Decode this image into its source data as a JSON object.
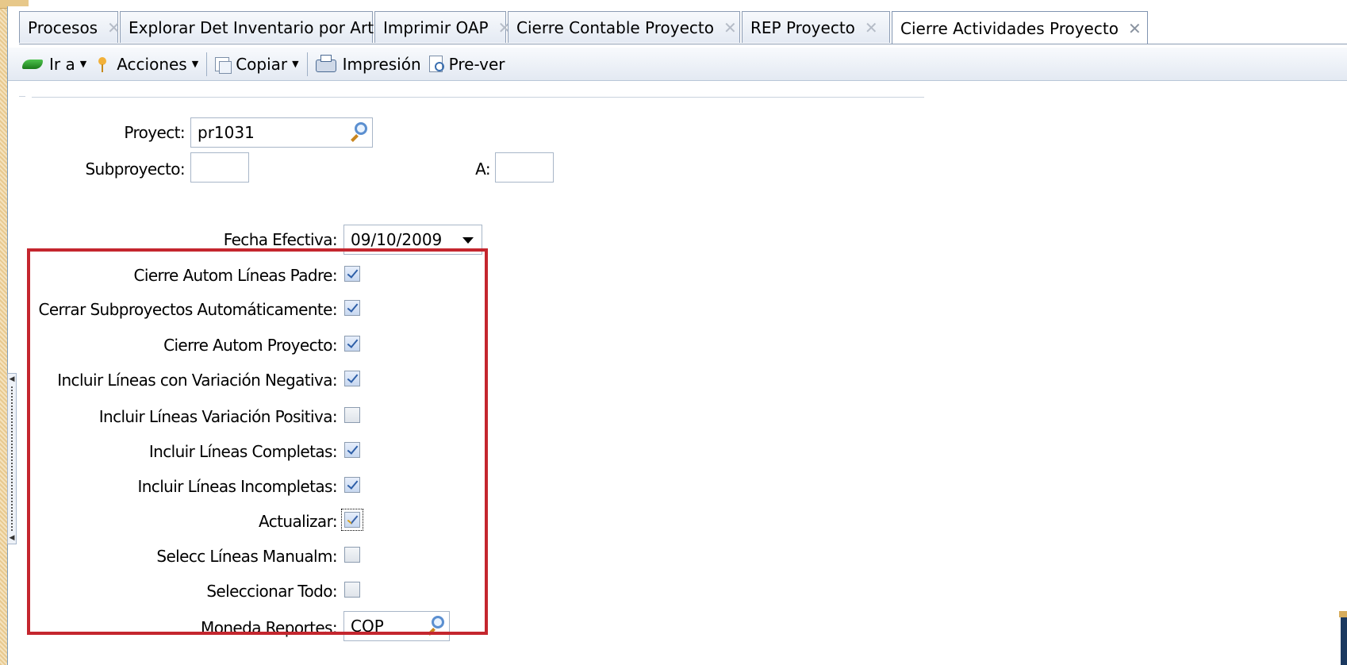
{
  "tabs": [
    {
      "label": "Procesos"
    },
    {
      "label": "Explorar Det Inventario por Art"
    },
    {
      "label": "Imprimir OAP"
    },
    {
      "label": "Cierre Contable Proyecto"
    },
    {
      "label": "REP Proyecto"
    },
    {
      "label": "Cierre Actividades Proyecto",
      "active": true
    }
  ],
  "tab_close_glyph": "✕",
  "toolbar": {
    "goto_label": "Ir a",
    "actions_label": "Acciones",
    "copy_label": "Copiar",
    "print_label": "Impresión",
    "preview_label": "Pre-ver"
  },
  "form": {
    "project_label": "Proyect:",
    "project_value": "pr1031",
    "subproject_label": "Subproyecto:",
    "subproject_value": "",
    "to_label": "A:",
    "to_value": "",
    "effective_date_label": "Fecha Efectiva:",
    "effective_date_value": "09/10/2009",
    "options": [
      {
        "label": "Cierre Autom Líneas Padre:",
        "checked": true
      },
      {
        "label": "Cerrar Subproyectos Automáticamente:",
        "checked": true
      },
      {
        "label": "Cierre Autom Proyecto:",
        "checked": true
      },
      {
        "label": "Incluir Líneas con Variación Negativa:",
        "checked": true
      },
      {
        "label": "Incluir Líneas Variación Positiva:",
        "checked": false
      },
      {
        "label": "Incluir Líneas Completas:",
        "checked": true
      },
      {
        "label": "Incluir Líneas Incompletas:",
        "checked": true
      },
      {
        "label": "Actualizar:",
        "checked": true,
        "focused": true
      },
      {
        "label": "Selecc Líneas Manualm:",
        "checked": false
      },
      {
        "label": "Seleccionar Todo:",
        "checked": false
      }
    ],
    "currency_label": "Moneda Reportes:",
    "currency_value": "COP"
  },
  "colors": {
    "highlight_box": "#c4262e",
    "checkbox_check": "#2e5fa8",
    "tab_border": "#8c9cb3"
  }
}
